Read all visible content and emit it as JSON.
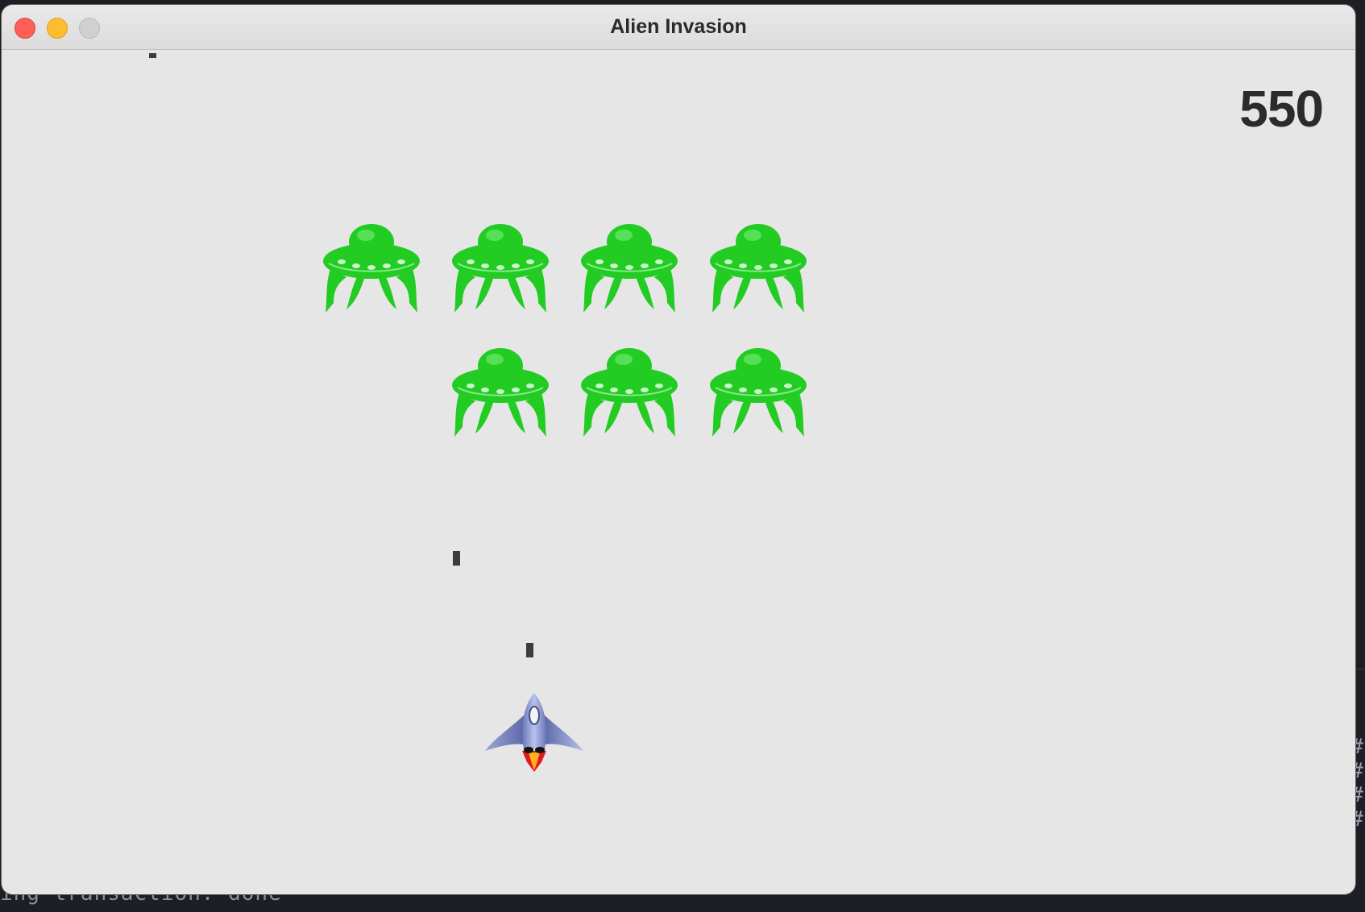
{
  "window": {
    "title": "Alien Invasion"
  },
  "hud": {
    "score": "550"
  },
  "background_terminal": {
    "line_1": "ing transaction: done",
    "hash_marks": [
      "#",
      "#",
      "#",
      "#"
    ]
  },
  "colors": {
    "alien": "#22cc22",
    "game_bg": "#e6e6e6",
    "bullet": "#3c3c3c"
  },
  "icons": {
    "alien": "alien-ufo-icon",
    "ship": "rocket-ship-icon"
  }
}
